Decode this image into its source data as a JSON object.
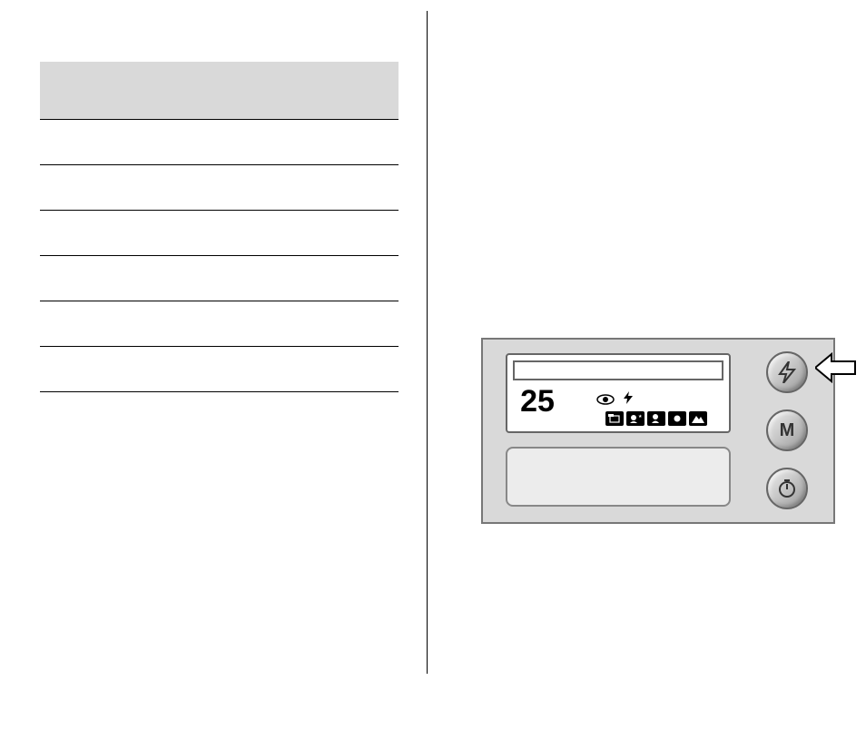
{
  "lcd": {
    "counter": "25"
  },
  "buttons": {
    "flash": "",
    "mode": "M",
    "timer": ""
  },
  "icons": {
    "eye": "eye-icon",
    "bolt": "bolt-icon",
    "modes": [
      "mode-1",
      "mode-2",
      "mode-3",
      "mode-4",
      "mode-5"
    ]
  }
}
